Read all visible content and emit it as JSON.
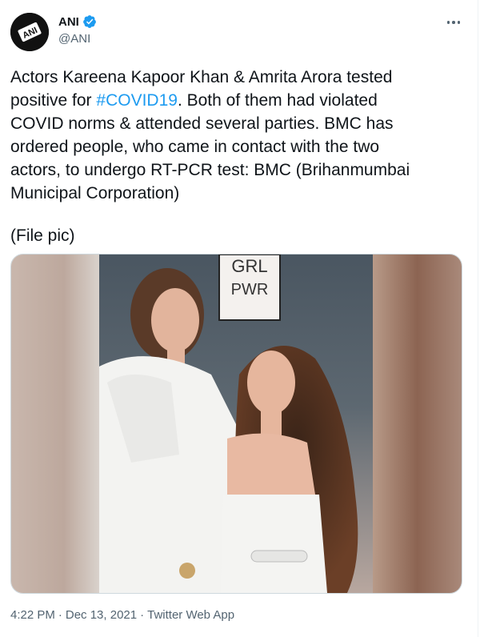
{
  "author": {
    "name": "ANI",
    "handle": "@ANI",
    "avatar_text": "ANI",
    "verified_icon": "verified-badge-icon",
    "verified_color": "#1d9bf0"
  },
  "tweet": {
    "text_before": "Actors Kareena Kapoor Khan & Amrita Arora tested\npositive for ",
    "hashtag": "#COVID19",
    "text_after": ". Both of them had violated\nCOVID norms & attended several parties. BMC has\nordered people, who came in contact with the two\nactors, to undergo RT-PCR test: BMC (Brihanmumbai\nMunicipal Corporation)",
    "file_note": "(File pic)"
  },
  "media": {
    "sign_line1": "GRL",
    "sign_line2": "PWR"
  },
  "meta": {
    "time": "4:22 PM",
    "separator1": "·",
    "date": "Dec 13, 2021",
    "separator2": "·",
    "source": "Twitter Web App"
  },
  "colors": {
    "text": "#0f1419",
    "secondary": "#536471",
    "link": "#1d9bf0"
  }
}
